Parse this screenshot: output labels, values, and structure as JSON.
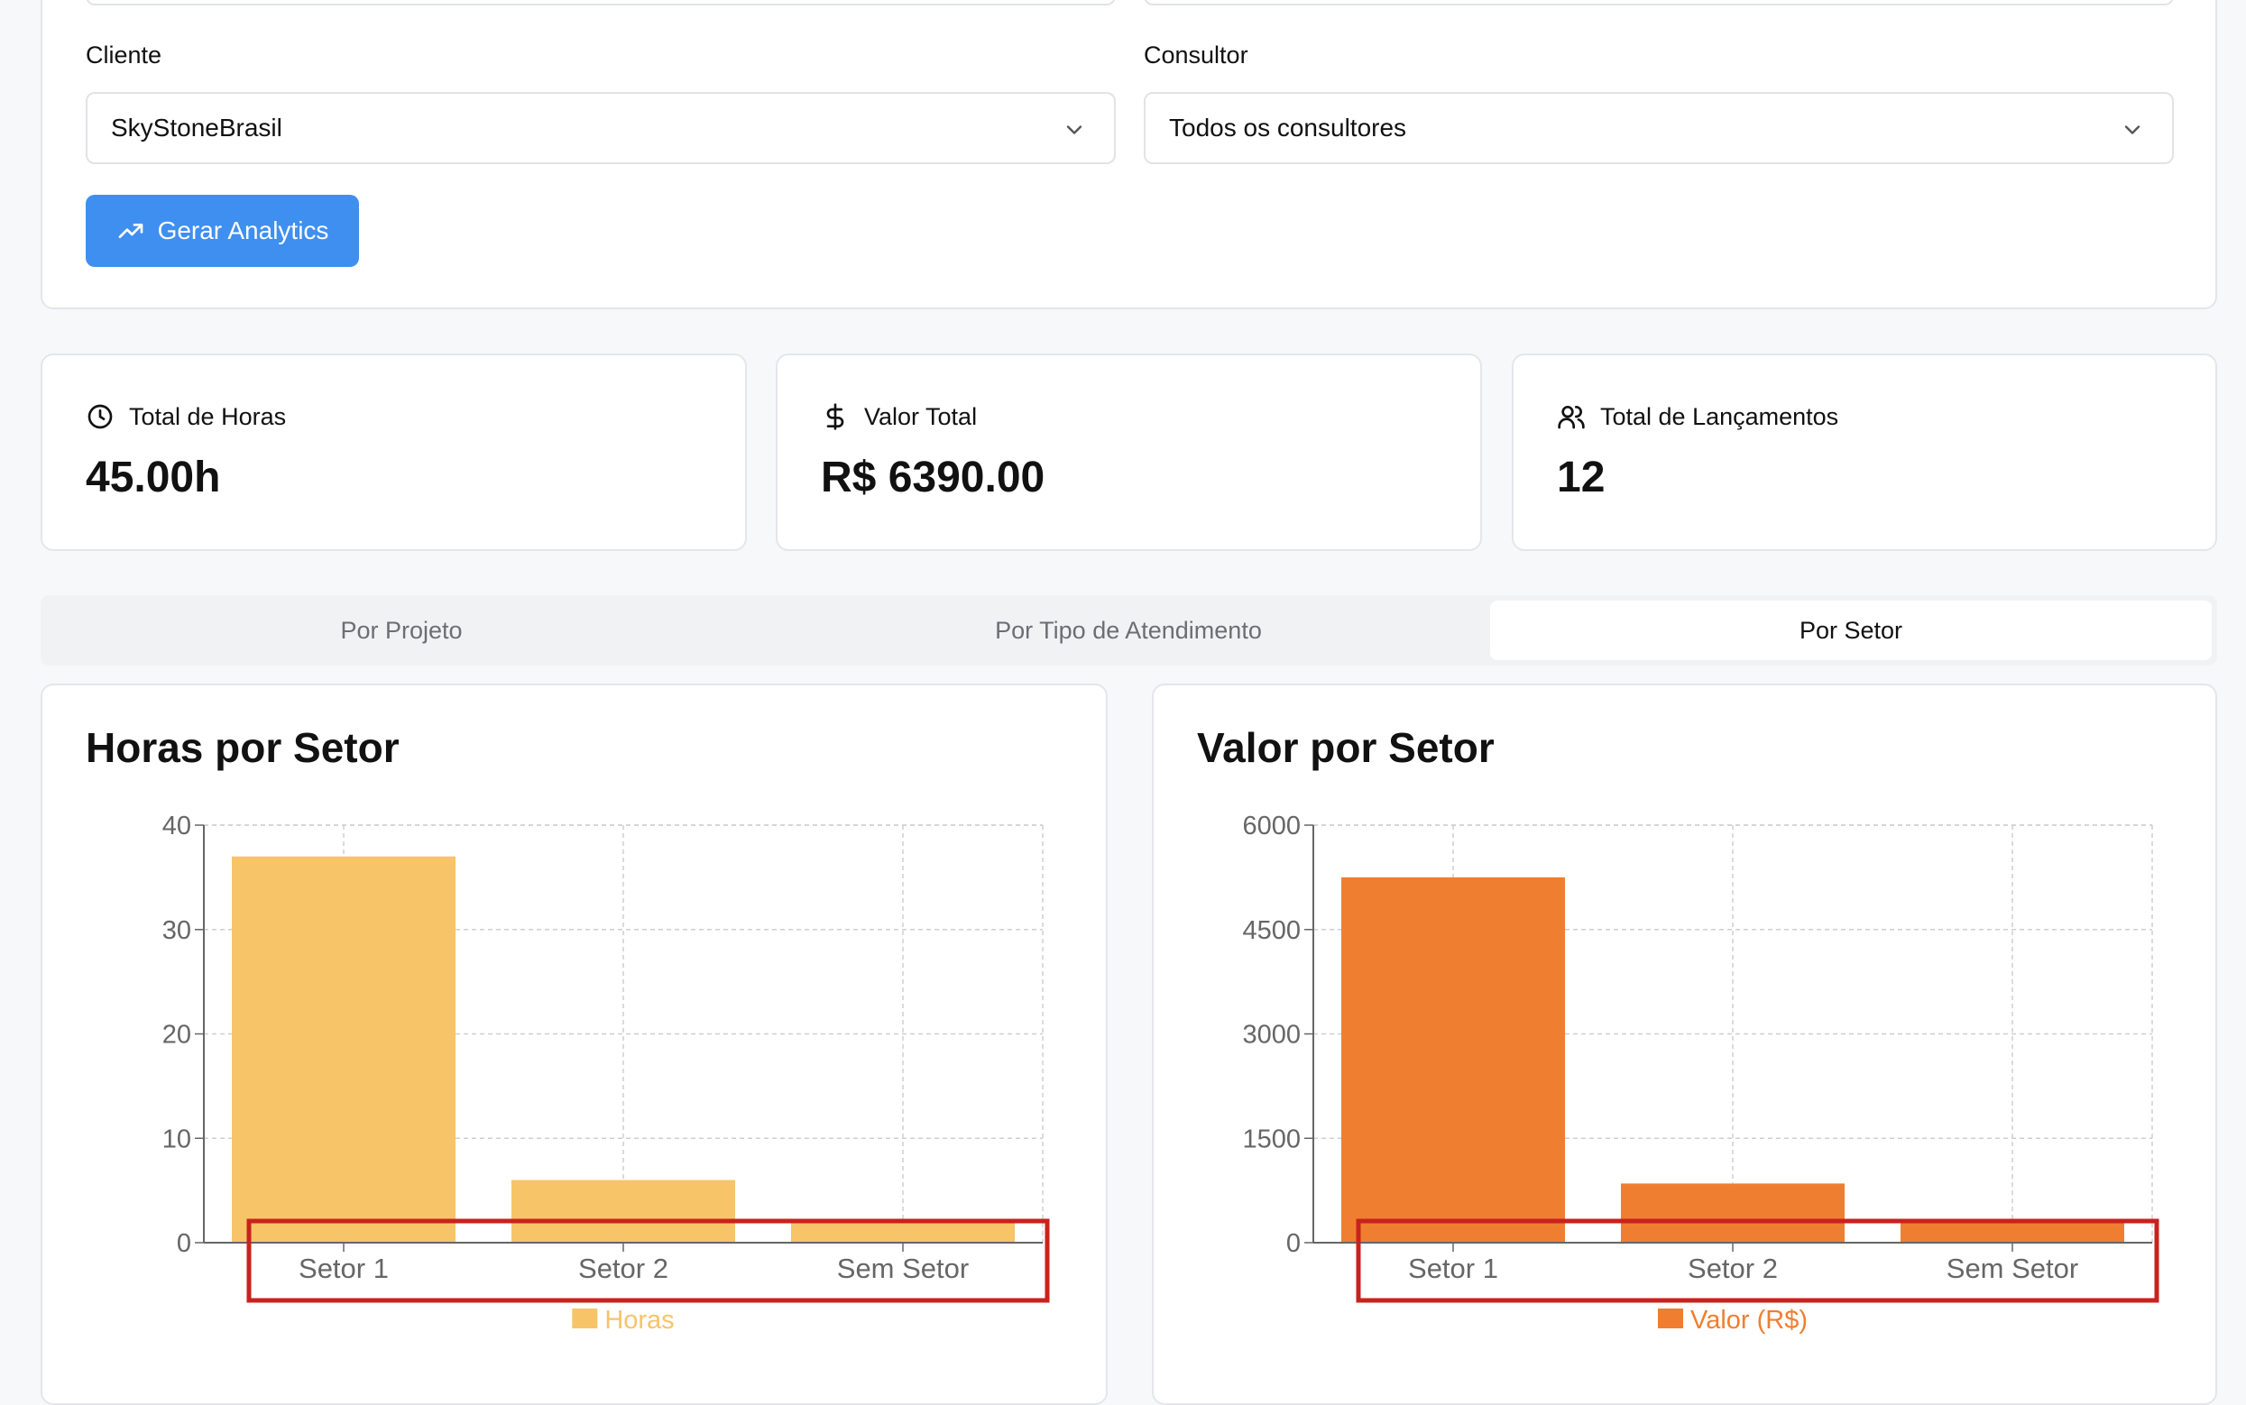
{
  "filters": {
    "client_label": "Cliente",
    "client_value": "SkyStoneBrasil",
    "consultant_label": "Consultor",
    "consultant_value": "Todos os consultores",
    "generate_label": "Gerar Analytics"
  },
  "stats": [
    {
      "title": "Total de Horas",
      "value": "45.00h",
      "icon": "clock-icon"
    },
    {
      "title": "Valor Total",
      "value": "R$ 6390.00",
      "icon": "dollar-icon"
    },
    {
      "title": "Total de Lançamentos",
      "value": "12",
      "icon": "users-icon"
    }
  ],
  "tabs": [
    {
      "label": "Por Projeto",
      "active": false
    },
    {
      "label": "Por Tipo de Atendimento",
      "active": false
    },
    {
      "label": "Por Setor",
      "active": true
    }
  ],
  "chart_data": [
    {
      "type": "bar",
      "title": "Horas por Setor",
      "categories": [
        "Setor 1",
        "Setor 2",
        "Sem Setor"
      ],
      "series": [
        {
          "name": "Horas",
          "values": [
            37,
            6,
            2
          ]
        }
      ],
      "ylim": [
        0,
        40
      ],
      "yticks": [
        0,
        10,
        20,
        30,
        40
      ],
      "color": "#f7c468",
      "grid": true,
      "legend": "bottom"
    },
    {
      "type": "bar",
      "title": "Valor por Setor",
      "categories": [
        "Setor 1",
        "Setor 2",
        "Sem Setor"
      ],
      "series": [
        {
          "name": "Valor (R$)",
          "values": [
            5250,
            850,
            290
          ]
        }
      ],
      "ylim": [
        0,
        6000
      ],
      "yticks": [
        0,
        1500,
        3000,
        4500,
        6000
      ],
      "color": "#f07e30",
      "grid": true,
      "legend": "bottom"
    }
  ]
}
